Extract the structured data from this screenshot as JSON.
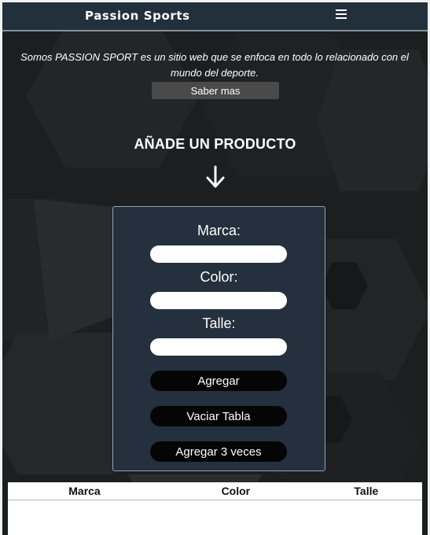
{
  "navbar": {
    "brand": "Passion Sports",
    "menu_icon": "hamburger-menu-icon"
  },
  "intro": {
    "text": "Somos  PASSION SPORT  es un sitio web que se enfoca en todo lo relacionado con el mundo del deporte.",
    "button_label": "Saber mas"
  },
  "product_section": {
    "title": "AÑADE UN PRODUCTO",
    "arrow_icon": "arrow-down-icon"
  },
  "form": {
    "marca_label": "Marca:",
    "marca_value": "",
    "color_label": "Color:",
    "color_value": "",
    "talle_label": "Talle:",
    "talle_value": "",
    "buttons": {
      "agregar": "Agregar",
      "vaciar": "Vaciar Tabla",
      "agregar3": "Agregar 3 veces"
    }
  },
  "table": {
    "headers": [
      "Marca",
      "Color",
      "Talle"
    ],
    "rows": []
  },
  "colors": {
    "navbar_bg": "#22303c",
    "page_bg": "#1a1b1d",
    "form_bg": "#24303d",
    "button_bg": "#050505"
  }
}
